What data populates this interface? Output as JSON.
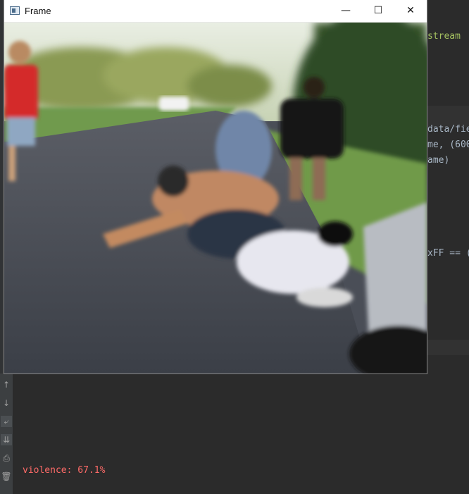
{
  "editor": {
    "lines": [
      {
        "text": "stream",
        "cls": "kw"
      },
      {
        "text": "data/fie",
        "cls": ""
      },
      {
        "text": "me, (600",
        "cls": ""
      },
      {
        "text": "ame)",
        "cls": ""
      },
      {
        "text": "xFF == (",
        "cls": ""
      }
    ]
  },
  "frame_window": {
    "title": "Frame",
    "minimize_glyph": "—",
    "maximize_glyph": "☐",
    "close_glyph": "✕"
  },
  "run_toolbar": {
    "icons": [
      "arrow-up-icon",
      "arrow-down-icon",
      "soft-wrap-icon",
      "scroll-to-end-icon",
      "print-icon",
      "trash-icon"
    ]
  },
  "console": {
    "output": "violence: 67.1%"
  },
  "colors": {
    "ide_background": "#2b2b2b",
    "console_error_text": "#ff6b68",
    "window_titlebar": "#ffffff"
  }
}
